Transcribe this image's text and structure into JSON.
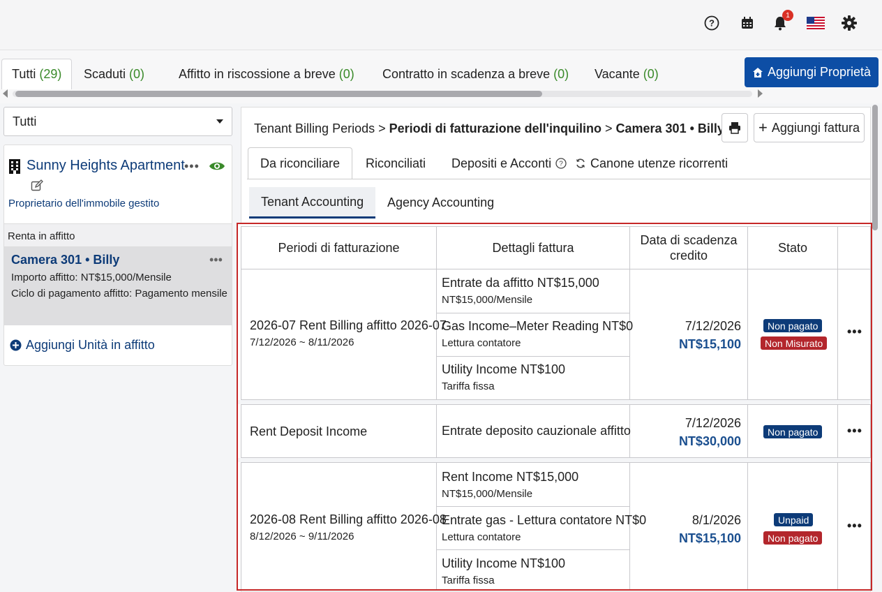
{
  "header": {
    "icons": [
      "help-icon",
      "calendar-icon",
      "bell-icon",
      "us-flag-icon",
      "gear-icon"
    ],
    "notification_count": "1"
  },
  "tabs": [
    {
      "label": "Tutti",
      "count": "(29)"
    },
    {
      "label": "Scaduti",
      "count": "(0)"
    },
    {
      "label": "Affitto in riscossione a breve",
      "count": "(0)"
    },
    {
      "label": "Contratto in scadenza a breve",
      "count": "(0)"
    },
    {
      "label": "Vacante",
      "count": "(0)"
    }
  ],
  "add_property_label": "Aggiungi Proprietà",
  "filter": {
    "value": "Tutti"
  },
  "property": {
    "name": "Sunny Heights Apartment",
    "owner": "Proprietario dell'immobile gestito",
    "rent_section": "Renta in affitto",
    "unit": {
      "name": "Camera 301 • Billy",
      "amount": "Importo affitto: NT$15,000/Mensile",
      "cycle": "Ciclo di pagamento affitto: Pagamento mensile"
    },
    "add_unit_label": "Aggiungi Unità in affitto"
  },
  "breadcrumb": {
    "part1": "Tenant Billing Periods",
    "sep": ">",
    "part2": "Periodi di fatturazione dell'inquilino",
    "part3": "Camera 301 • Billy"
  },
  "add_invoice_label": "Aggiungi fattura",
  "subtabs": [
    "Da riconciliare",
    "Riconciliati",
    "Depositi e Acconti",
    "Canone utenze ricorrenti"
  ],
  "acc_tabs": [
    "Tenant Accounting",
    "Agency Accounting"
  ],
  "table": {
    "headers": [
      "Periodi di fatturazione",
      "Dettagli fattura",
      "Data di scadenza credito",
      "Stato"
    ],
    "groups": [
      {
        "period": "2026-07 Rent Billing affitto 2026-07",
        "range": "7/12/2026 ~ 8/11/2026",
        "details": [
          {
            "main": "Entrate da affitto NT$15,000",
            "sub": "NT$15,000/Mensile"
          },
          {
            "main": "Gas Income–Meter Reading NT$0",
            "sub": "Lettura contatore"
          },
          {
            "main": "Utility Income NT$100",
            "sub": "Tariffa fissa"
          }
        ],
        "date": "7/12/2026",
        "amount": "NT$15,100",
        "status": [
          "Non pagato",
          "Non Misurato"
        ]
      },
      {
        "period": "Rent Deposit Income",
        "range": "",
        "details": [
          {
            "main": "Entrate deposito cauzionale affitto",
            "sub": ""
          }
        ],
        "date": "7/12/2026",
        "amount": "NT$30,000",
        "status": [
          "Non pagato"
        ]
      },
      {
        "period": "2026-08 Rent Billing affitto 2026-08",
        "range": "8/12/2026 ~ 9/11/2026",
        "details": [
          {
            "main": "Rent Income NT$15,000",
            "sub": "NT$15,000/Mensile"
          },
          {
            "main": "Entrate gas - Lettura contatore NT$0",
            "sub": "Lettura contatore"
          },
          {
            "main": "Utility Income NT$100",
            "sub": "Tariffa fissa"
          }
        ],
        "date": "8/1/2026",
        "amount": "NT$15,100",
        "status": [
          "Unpaid",
          "Non pagato"
        ]
      }
    ]
  },
  "colors": {
    "primary": "#0d4ea5",
    "navy": "#0d3b78",
    "count_green": "#3a8a2a",
    "danger": "#b3262c",
    "highlight_border": "#c62828"
  }
}
